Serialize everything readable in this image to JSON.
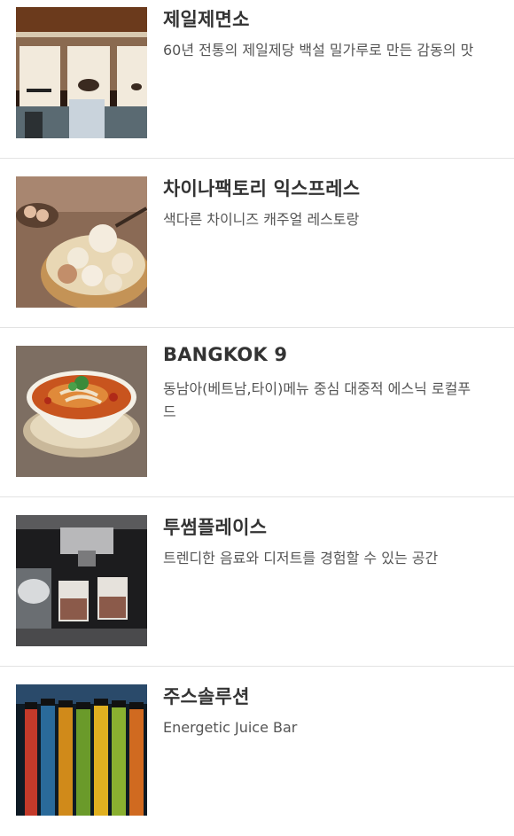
{
  "restaurants": [
    {
      "name": "제일제면소",
      "description": "60년 전통의 제일제당 백설 밀가루로 만든 감동의 맛",
      "icon": "noodle-shop-photo"
    },
    {
      "name": "차이나팩토리 익스프레스",
      "description": "색다른 차이니즈 캐주얼 레스토랑",
      "icon": "dim-sum-photo"
    },
    {
      "name": "BANGKOK 9",
      "description": "동남아(베트남,타이)메뉴 중심 대중적 에스닉 로컬푸드",
      "icon": "thai-soup-photo"
    },
    {
      "name": "투썸플레이스",
      "description": "트렌디한 음료와 디저트를 경험할 수 있는 공간",
      "icon": "espresso-photo"
    },
    {
      "name": "주스솔루션",
      "description": "Energetic Juice Bar",
      "icon": "juice-bottles-photo"
    }
  ]
}
